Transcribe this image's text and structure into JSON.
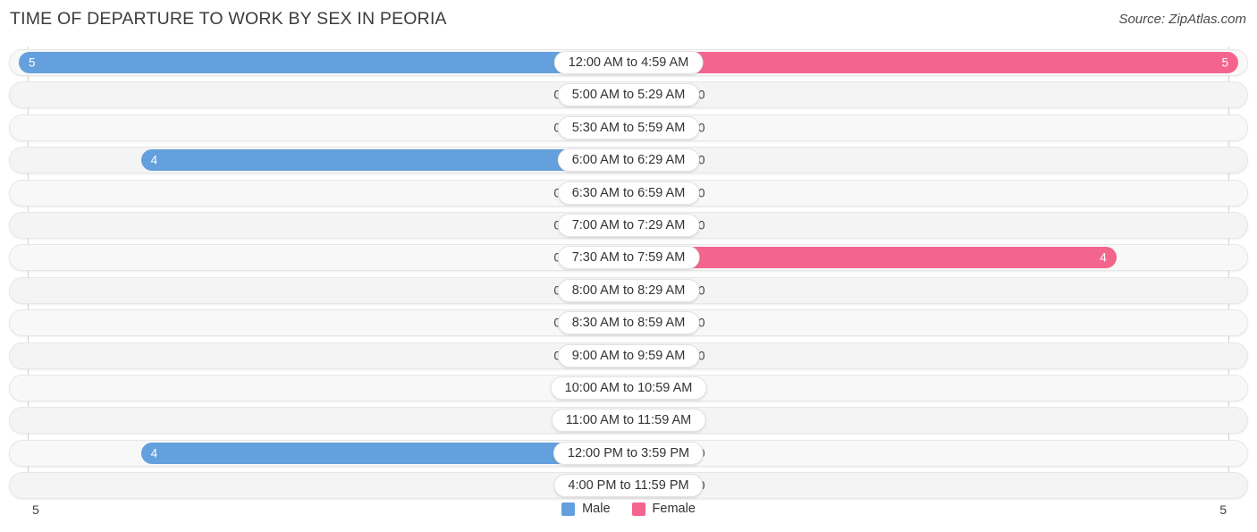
{
  "header": {
    "title": "TIME OF DEPARTURE TO WORK BY SEX IN PEORIA",
    "source": "Source: ZipAtlas.com"
  },
  "legend": {
    "male_label": "Male",
    "female_label": "Female",
    "male_color": "#63a0dd",
    "female_color": "#f4658e",
    "male_zero_color": "#aecbec",
    "female_zero_color": "#f7a8c2"
  },
  "axis": {
    "left_tick": "5",
    "right_tick": "5",
    "max": 5
  },
  "chart_data": {
    "type": "bar",
    "title": "TIME OF DEPARTURE TO WORK BY SEX IN PEORIA",
    "subtitle": "Source: ZipAtlas.com",
    "orientation": "horizontal-diverging",
    "xlabel": "",
    "ylabel": "",
    "xlim": [
      5,
      5
    ],
    "grid": false,
    "legend_position": "bottom-center",
    "categories": [
      "12:00 AM to 4:59 AM",
      "5:00 AM to 5:29 AM",
      "5:30 AM to 5:59 AM",
      "6:00 AM to 6:29 AM",
      "6:30 AM to 6:59 AM",
      "7:00 AM to 7:29 AM",
      "7:30 AM to 7:59 AM",
      "8:00 AM to 8:29 AM",
      "8:30 AM to 8:59 AM",
      "9:00 AM to 9:59 AM",
      "10:00 AM to 10:59 AM",
      "11:00 AM to 11:59 AM",
      "12:00 PM to 3:59 PM",
      "4:00 PM to 11:59 PM"
    ],
    "series": [
      {
        "name": "Male",
        "values": [
          5,
          0,
          0,
          4,
          0,
          0,
          0,
          0,
          0,
          0,
          0,
          0,
          4,
          0
        ]
      },
      {
        "name": "Female",
        "values": [
          5,
          0,
          0,
          0,
          0,
          0,
          4,
          0,
          0,
          0,
          0,
          0,
          0,
          0
        ]
      }
    ]
  },
  "rows": [
    {
      "label": "12:00 AM to 4:59 AM",
      "male": "5",
      "female": "5"
    },
    {
      "label": "5:00 AM to 5:29 AM",
      "male": "0",
      "female": "0"
    },
    {
      "label": "5:30 AM to 5:59 AM",
      "male": "0",
      "female": "0"
    },
    {
      "label": "6:00 AM to 6:29 AM",
      "male": "4",
      "female": "0"
    },
    {
      "label": "6:30 AM to 6:59 AM",
      "male": "0",
      "female": "0"
    },
    {
      "label": "7:00 AM to 7:29 AM",
      "male": "0",
      "female": "0"
    },
    {
      "label": "7:30 AM to 7:59 AM",
      "male": "0",
      "female": "4"
    },
    {
      "label": "8:00 AM to 8:29 AM",
      "male": "0",
      "female": "0"
    },
    {
      "label": "8:30 AM to 8:59 AM",
      "male": "0",
      "female": "0"
    },
    {
      "label": "9:00 AM to 9:59 AM",
      "male": "0",
      "female": "0"
    },
    {
      "label": "10:00 AM to 10:59 AM",
      "male": "0",
      "female": "0"
    },
    {
      "label": "11:00 AM to 11:59 AM",
      "male": "0",
      "female": "0"
    },
    {
      "label": "12:00 PM to 3:59 PM",
      "male": "4",
      "female": "0"
    },
    {
      "label": "4:00 PM to 11:59 PM",
      "male": "0",
      "female": "0"
    }
  ]
}
